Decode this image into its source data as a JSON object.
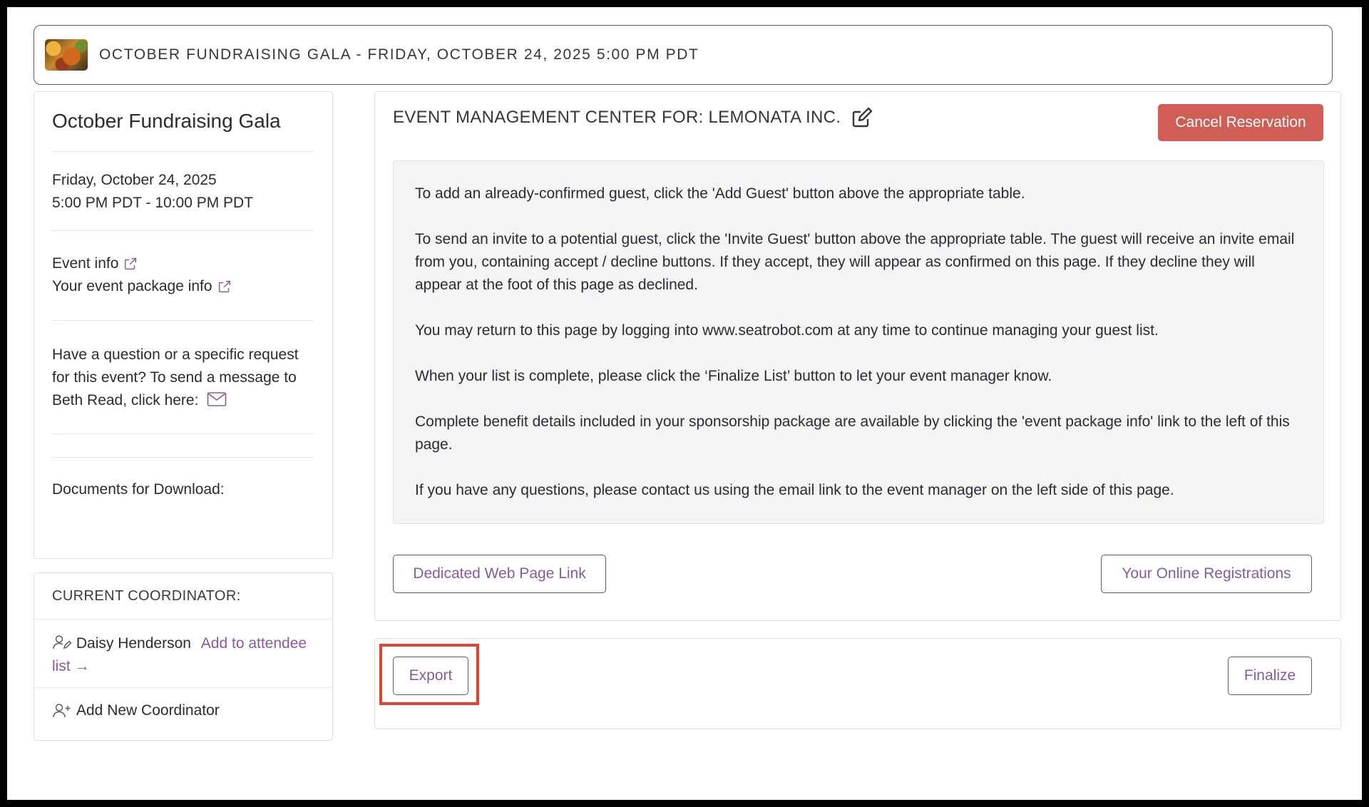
{
  "topbar": {
    "title": "OCTOBER FUNDRAISING GALA - FRIDAY, OCTOBER 24, 2025 5:00 PM PDT"
  },
  "event": {
    "name": "October Fundraising Gala",
    "date": "Friday, October 24, 2025",
    "time": "5:00 PM PDT - 10:00 PM PDT",
    "event_info_link": "Event info",
    "package_info_link": "Your event package info",
    "question_text": "Have a question or a specific request for this event? To send a message to Beth Read, click here:",
    "documents_label": "Documents for Download:"
  },
  "coordinator": {
    "heading": "CURRENT COORDINATOR:",
    "name": "Daisy Henderson",
    "add_to_list": "Add to attendee list",
    "add_new": "Add New Coordinator"
  },
  "main": {
    "heading": "EVENT MANAGEMENT CENTER FOR: LEMONATA INC.",
    "cancel_label": "Cancel Reservation",
    "info": [
      "To add an already-confirmed guest, click the 'Add Guest' button above the appropriate table.",
      "To send an invite to a potential guest, click the 'Invite Guest' button above the appropriate table. The guest will receive an invite email from you, containing accept / decline buttons. If they accept, they will appear as confirmed on this page. If they decline they will appear at the foot of this page as declined.",
      "You may return to this page by logging into www.seatrobot.com at any time to continue managing your guest list.",
      "When your list is complete, please click the ‘Finalize List’ button to let your event manager know.",
      "Complete benefit details included in your sponsorship package are available by clicking the 'event package info' link to the left of this page.",
      "If you have any questions, please contact us using the email link to the event manager on the left side of this page."
    ],
    "dedicated_link_label": "Dedicated Web Page Link",
    "online_registrations_label": "Your Online Registrations"
  },
  "footer": {
    "export_label": "Export",
    "finalize_label": "Finalize"
  },
  "colors": {
    "accent_purple": "#8a5a9e",
    "cancel_red": "#d05e57",
    "highlight_red": "#e0462f"
  }
}
